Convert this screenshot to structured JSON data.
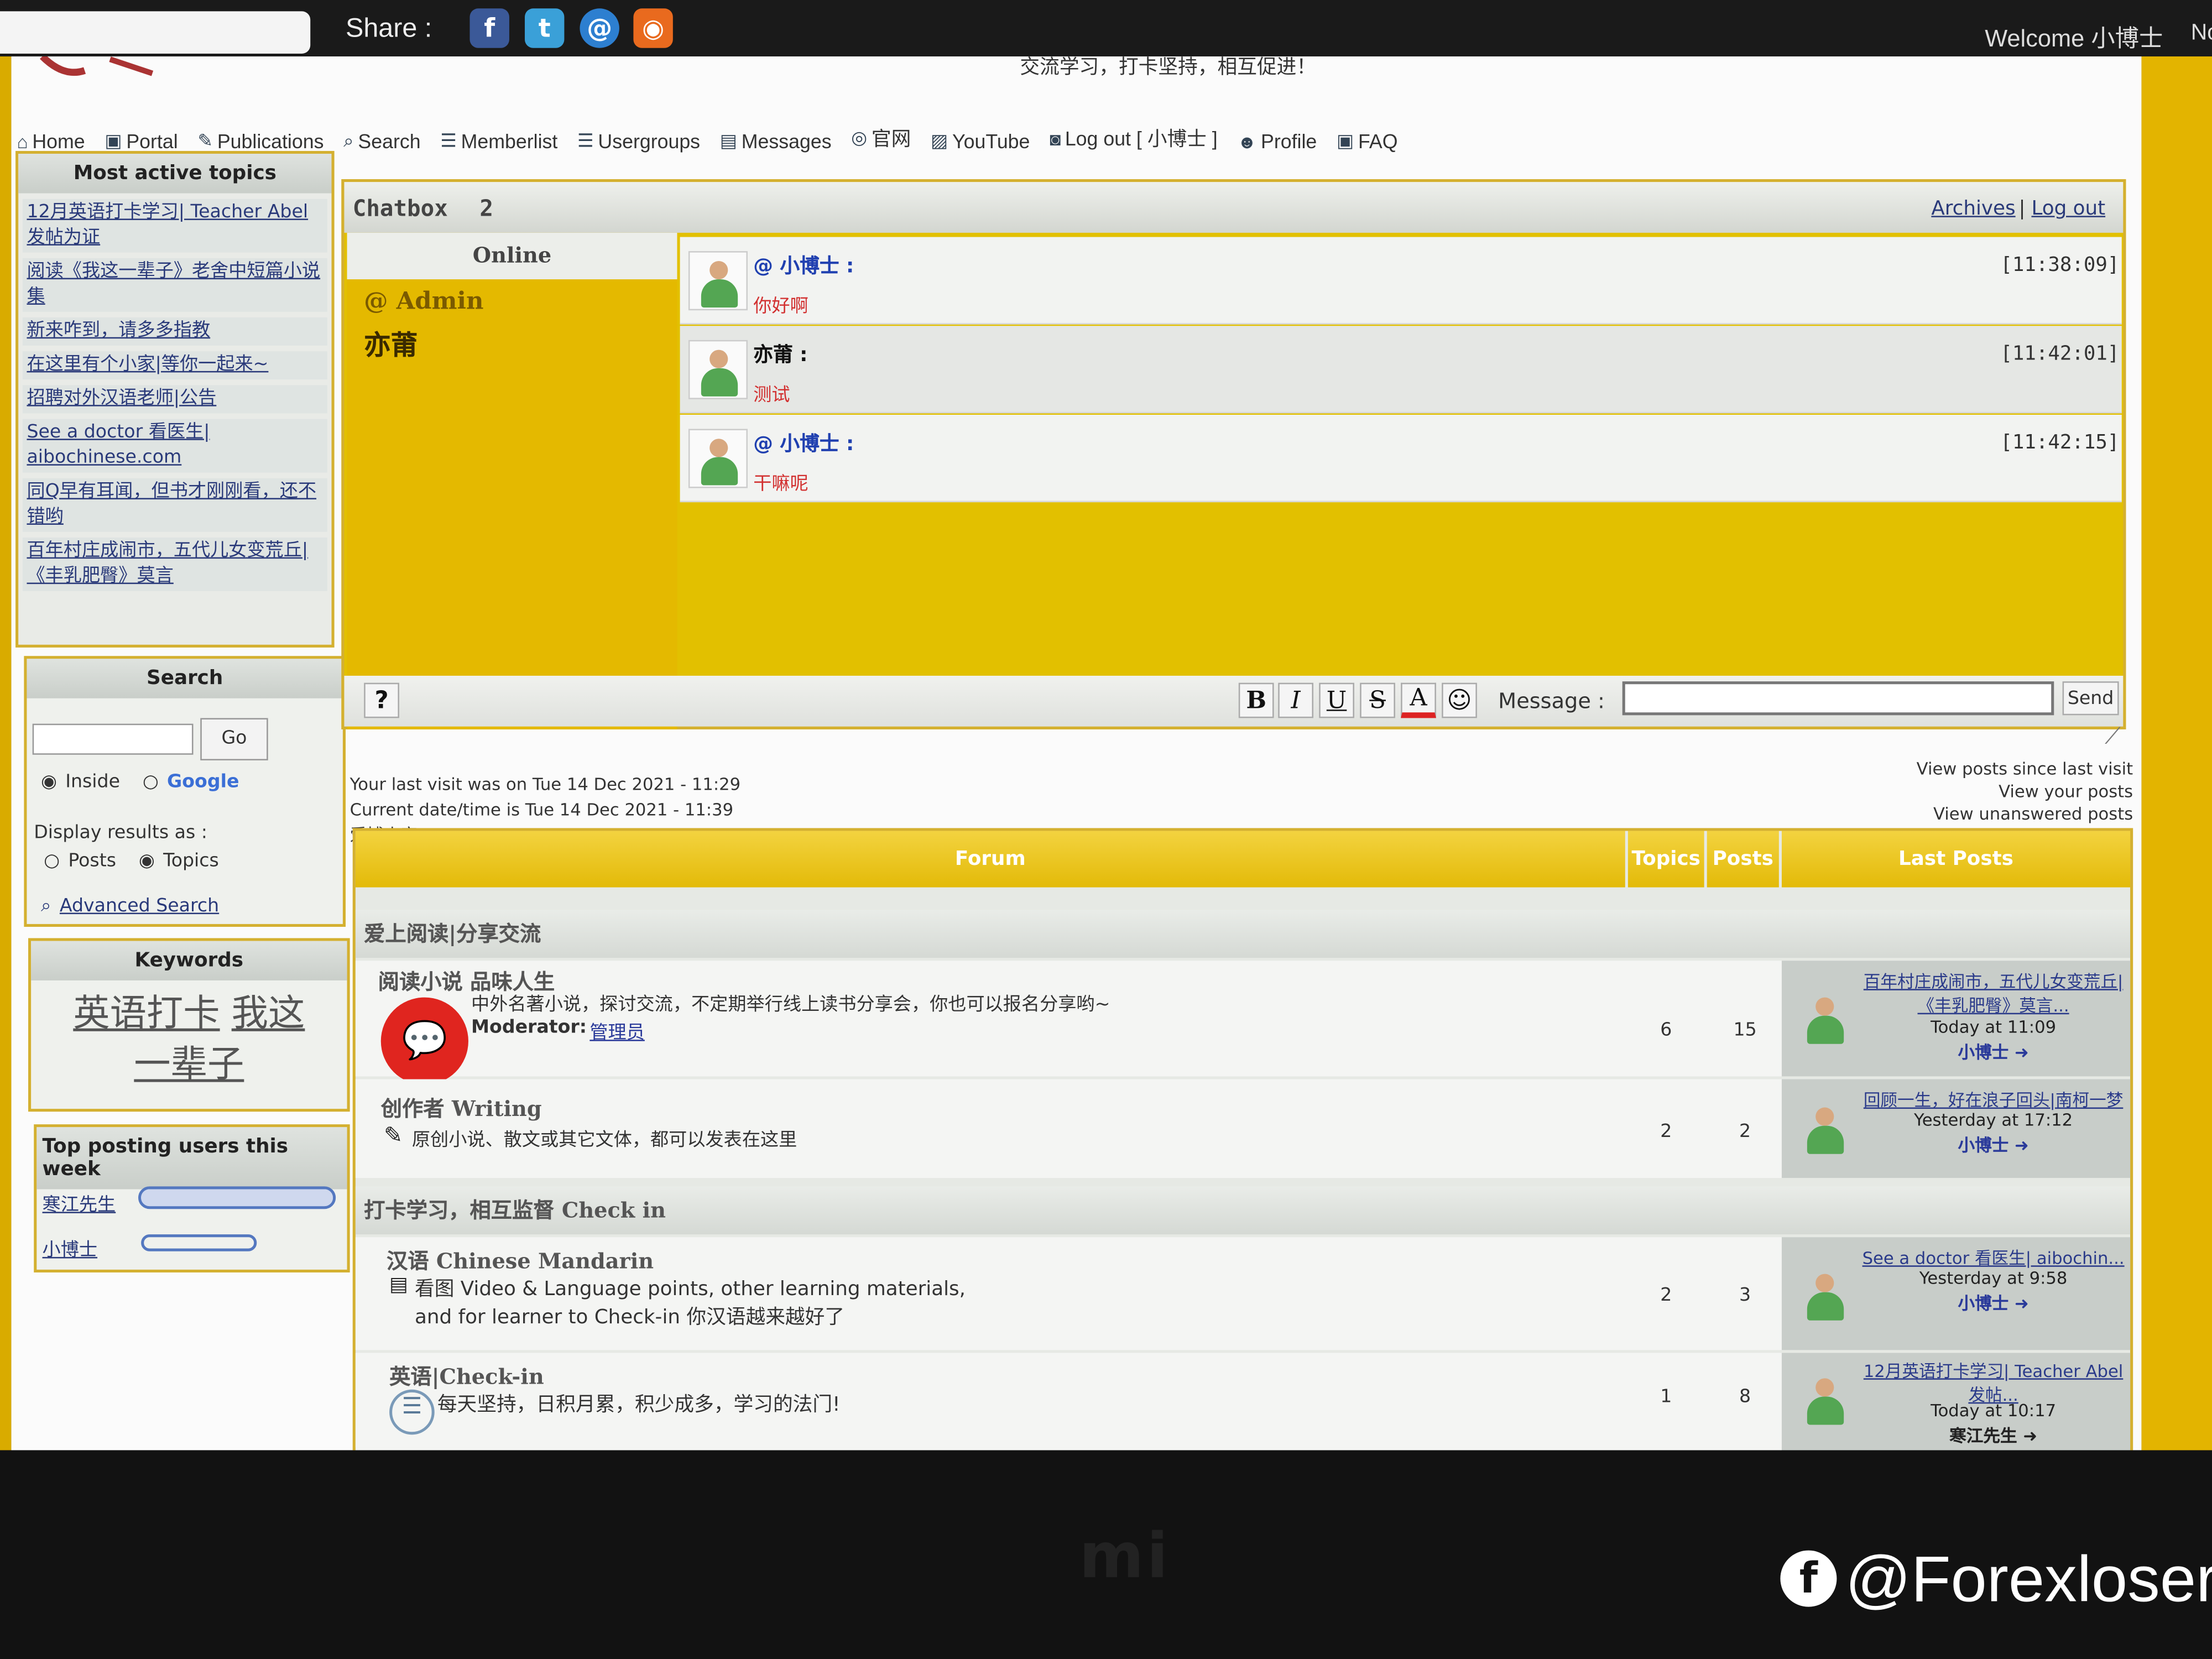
{
  "share": {
    "label": "Share :",
    "icons": [
      "facebook-icon",
      "twitter-icon",
      "email-icon",
      "rss-icon"
    ]
  },
  "welcome": "Welcome 小博士",
  "welcome_trunc": "No",
  "slogan": "交流学习，打卡坚持，相互促进！",
  "nav": [
    "Home",
    "Portal",
    "Publications",
    "Search",
    "Memberlist",
    "Usergroups",
    "Messages",
    "官网",
    "YouTube",
    "Log out [ 小博士 ]",
    "Profile",
    "FAQ"
  ],
  "most_active": {
    "title": "Most active topics",
    "topics": [
      "12月英语打卡学习| Teacher Abel 发帖为证",
      "阅读《我这一辈子》老舍中短篇小说集",
      "新来咋到，请多多指教",
      "在这里有个小家|等你一起来~",
      "招聘对外汉语老师|公告",
      "See a doctor 看医生| aibochinese.com",
      "同Q早有耳闻，但书才刚刚看，还不错哟",
      "百年村庄成闹市，五代儿女变荒丘|《丰乳肥臀》莫言"
    ]
  },
  "search": {
    "title": "Search",
    "go": "Go",
    "inside": "Inside",
    "google": "Google",
    "display_results": "Display results as :",
    "posts": "Posts",
    "topics": "Topics",
    "advanced": "Advanced Search"
  },
  "keywords": {
    "title": "Keywords",
    "words": [
      "英语打卡",
      "我这",
      "一辈子"
    ]
  },
  "top_posting": {
    "title": "Top posting users this week",
    "users": [
      {
        "name": "寒江先生",
        "fill": 1.0
      },
      {
        "name": "小博士",
        "fill": 0.6
      }
    ]
  },
  "chatbox": {
    "title": "Chatbox",
    "count": "2",
    "archives": "Archives",
    "logout": "Log out",
    "online_label": "Online",
    "online_users": [
      "@ Admin",
      "亦莆"
    ],
    "messages": [
      {
        "user": "@ 小博士 :",
        "text": "你好啊",
        "time": "[11:38:09]",
        "user_color": "#2040b0"
      },
      {
        "user": "亦莆 :",
        "text": "测试",
        "time": "[11:42:01]",
        "user_color": "#111111"
      },
      {
        "user": "@ 小博士 :",
        "text": "干嘛呢",
        "time": "[11:42:15]",
        "user_color": "#2040b0"
      }
    ],
    "help": "?",
    "bold": "B",
    "italic": "I",
    "underline": "U",
    "strike": "S",
    "color": "A",
    "message_label": "Message :",
    "send": "Send"
  },
  "visit": {
    "last_visit": "Your last visit was on Tue 14 Dec 2021 - 11:29",
    "current": "Current date/time is Tue 14 Dec 2021 - 11:39",
    "site": "爱博小家",
    "links": [
      "View posts since last visit",
      "View your posts",
      "View unanswered posts"
    ]
  },
  "forum": {
    "headers": {
      "forum": "Forum",
      "topics": "Topics",
      "posts": "Posts",
      "last_posts": "Last Posts"
    },
    "categories": [
      {
        "title": "爱上阅读|分享交流",
        "forums": [
          {
            "name": "阅读小说 品味人生",
            "desc": "中外名著小说，探讨交流，不定期举行线上读书分享会，你也可以报名分享哟~",
            "moderator_label": "Moderator:",
            "moderator": "管理员",
            "topics": "6",
            "posts": "15",
            "last_title": "百年村庄成闹市，五代儿女变荒丘|《丰乳肥臀》莫言...",
            "last_time": "Today at 11:09",
            "last_user": "小博士"
          },
          {
            "name": "创作者 Writing",
            "desc": "原创小说、散文或其它文体，都可以发表在这里",
            "topics": "2",
            "posts": "2",
            "last_title": "回顾一生，好在浪子回头|南柯一梦",
            "last_time": "Yesterday at 17:12",
            "last_user": "小博士"
          }
        ]
      },
      {
        "title": "打卡学习，相互监督 Check in",
        "forums": [
          {
            "name": "汉语 Chinese Mandarin",
            "desc": "看图 Video & Language points, other learning materials,",
            "desc2": "and for learner to Check-in 你汉语越来越好了",
            "topics": "2",
            "posts": "3",
            "last_title": "See a doctor 看医生| aibochin...",
            "last_time": "Yesterday at 9:58",
            "last_user": "小博士"
          },
          {
            "name": "英语|Check-in",
            "desc": "每天坚持，日积月累，积少成多，学习的法门!",
            "topics": "1",
            "posts": "8",
            "last_title": "12月英语打卡学习| Teacher Abel 发帖...",
            "last_time": "Today at 10:17",
            "last_user": "寒江先生"
          }
        ]
      }
    ]
  },
  "bezel": {
    "brand": "mi"
  },
  "watermark": "@Forexloser"
}
